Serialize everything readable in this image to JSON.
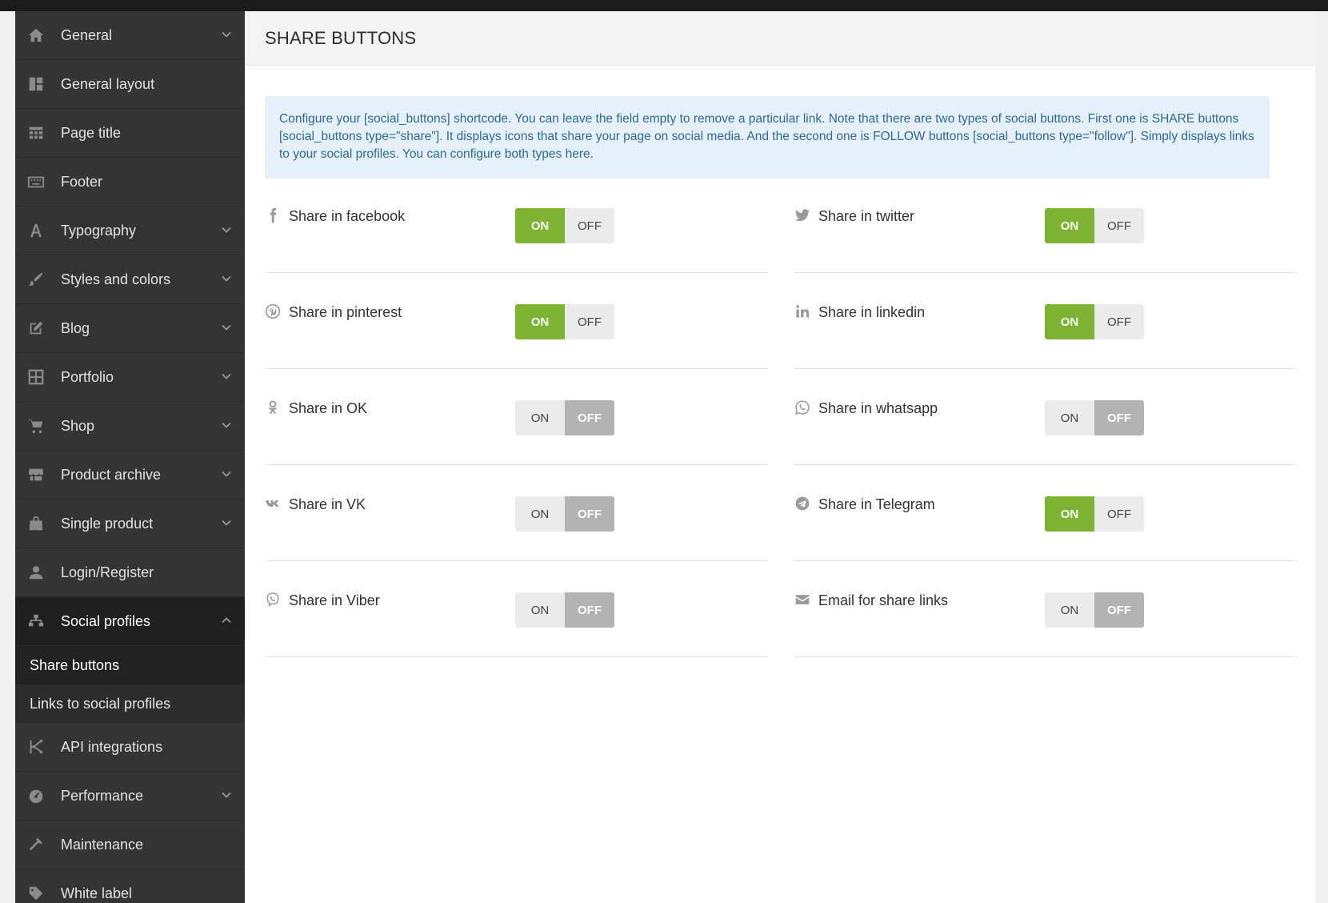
{
  "sidebar": {
    "items": [
      {
        "label": "General",
        "icon": "home-icon",
        "chevron": "down"
      },
      {
        "label": "General layout",
        "icon": "layout-icon",
        "chevron": ""
      },
      {
        "label": "Page title",
        "icon": "grid-icon",
        "chevron": ""
      },
      {
        "label": "Footer",
        "icon": "keyboard-icon",
        "chevron": ""
      },
      {
        "label": "Typography",
        "icon": "font-icon",
        "chevron": "down"
      },
      {
        "label": "Styles and colors",
        "icon": "brush-icon",
        "chevron": "down"
      },
      {
        "label": "Blog",
        "icon": "edit-icon",
        "chevron": "down"
      },
      {
        "label": "Portfolio",
        "icon": "portfolio-icon",
        "chevron": "down"
      },
      {
        "label": "Shop",
        "icon": "cart-icon",
        "chevron": "down"
      },
      {
        "label": "Product archive",
        "icon": "store-icon",
        "chevron": "down"
      },
      {
        "label": "Single product",
        "icon": "bag-icon",
        "chevron": "down"
      },
      {
        "label": "Login/Register",
        "icon": "user-icon",
        "chevron": ""
      },
      {
        "label": "Social profiles",
        "icon": "sitemap-icon",
        "chevron": "up"
      }
    ],
    "subitems": [
      {
        "label": "Share buttons"
      },
      {
        "label": "Links to social profiles"
      }
    ],
    "items_after": [
      {
        "label": "API integrations",
        "icon": "api-icon",
        "chevron": ""
      },
      {
        "label": "Performance",
        "icon": "dashboard-icon",
        "chevron": "down"
      },
      {
        "label": "Maintenance",
        "icon": "hammer-icon",
        "chevron": ""
      },
      {
        "label": "White label",
        "icon": "tag-icon",
        "chevron": ""
      }
    ]
  },
  "main": {
    "title": "SHARE BUTTONS",
    "notice": "Configure your [social_buttons] shortcode. You can leave the field empty to remove a particular link. Note that there are two types of social buttons. First one is SHARE buttons [social_buttons type=\"share\"]. It displays icons that share your page on social media. And the second one is FOLLOW buttons [social_buttons type=\"follow\"]. Simply displays links to your social profiles. You can configure both types here.",
    "toggle_on_label": "ON",
    "toggle_off_label": "OFF",
    "options": [
      {
        "label": "Share in facebook",
        "icon": "facebook-icon",
        "state": "on"
      },
      {
        "label": "Share in twitter",
        "icon": "twitter-icon",
        "state": "on"
      },
      {
        "label": "Share in pinterest",
        "icon": "pinterest-icon",
        "state": "on"
      },
      {
        "label": "Share in linkedin",
        "icon": "linkedin-icon",
        "state": "on"
      },
      {
        "label": "Share in OK",
        "icon": "odnoklassniki-icon",
        "state": "off"
      },
      {
        "label": "Share in whatsapp",
        "icon": "whatsapp-icon",
        "state": "off"
      },
      {
        "label": "Share in VK",
        "icon": "vk-icon",
        "state": "off"
      },
      {
        "label": "Share in Telegram",
        "icon": "telegram-icon",
        "state": "on"
      },
      {
        "label": "Share in Viber",
        "icon": "viber-icon",
        "state": "off"
      },
      {
        "label": "Email for share links",
        "icon": "email-icon",
        "state": "off"
      }
    ]
  },
  "colors": {
    "toggle_on": "#7cb330",
    "toggle_off_active": "#b3b3b3",
    "sidebar_bg": "#343434",
    "notice_bg": "#e5f0f9",
    "notice_text": "#2d6b99"
  }
}
